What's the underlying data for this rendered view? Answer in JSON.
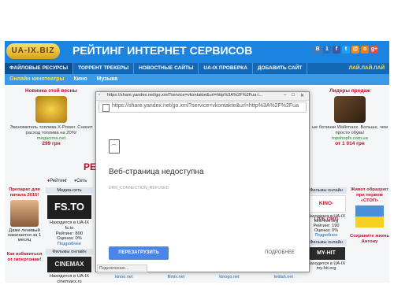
{
  "site": {
    "logo_text": "UA-IX.BIZ",
    "title": "РЕЙТИНГ ИНТЕРНЕТ СЕРВИСОВ",
    "social": [
      {
        "label": "В",
        "color": "#4a76a8",
        "icon": "vk-icon"
      },
      {
        "label": "1",
        "color": "#2a6ebb",
        "icon": "one-icon"
      },
      {
        "label": "f",
        "color": "#3b5998",
        "icon": "facebook-icon"
      },
      {
        "label": "t",
        "color": "#1da1f2",
        "icon": "twitter-icon"
      },
      {
        "label": "@",
        "color": "#f28b0c",
        "icon": "mail-icon"
      },
      {
        "label": "o",
        "color": "#ee8208",
        "icon": "ok-icon"
      },
      {
        "label": "g+",
        "color": "#dc4e41",
        "icon": "googleplus-icon"
      }
    ]
  },
  "nav": {
    "items": [
      "ФАЙЛОВЫЕ РЕСУРСЫ",
      "ТОРРЕНТ ТРЕКЕРЫ",
      "НОВОСТНЫЕ САЙТЫ",
      "UA-IX ПРОВЕРКА",
      "ДОБАВИТЬ САЙТ"
    ],
    "right": "ЛАЙ.ЛАЙ.ЛАЙ",
    "sub": [
      "Онлайн кинотеатры",
      "Кино",
      "Музыка"
    ]
  },
  "promo_left": {
    "title": "Новинка этой весны",
    "text": "Экономитель топлива X-Power. Снизит расход топлива на 20%!",
    "url": "megacima.net",
    "price": "299 грн"
  },
  "promo_right": {
    "title": "Лидеры продаж",
    "text": "ые ботинки Walkmaxx. Больше, чем просто обувь!",
    "url": "topshopfx.com.ua",
    "price": "от 1 014 грн"
  },
  "letter": "РЕ",
  "hint_left": "Рейтинг",
  "hint_right": "Сеть",
  "lower_left": {
    "title": "Препарат для начала 2015!",
    "caption": "Даже ленивый накачается за 1 месяц"
  },
  "lower_left2": "Как избавиться от гипертонии!",
  "card": {
    "header": "Медиа-сеть",
    "logo": "FS.TO",
    "lines": [
      "Находится в UA-IX",
      "fs.to",
      "Рейтинг: 800",
      "Оценка: 0%"
    ],
    "link": "Подробнее",
    "header2": "Фильмы онлайн",
    "logo2": "CINEMAX",
    "line2": "Находится в UA-IX",
    "url2": "cinemaxx.ru"
  },
  "rcard": {
    "header": "Фильмы онлайн",
    "logo": "KINO-LIVE.ORG",
    "lines": [
      "Находится в UA-IX",
      "kino-live.org",
      "Рейтинг: 190",
      "Оценка: 0%"
    ],
    "link": "Подробнее",
    "header2": "Фильмы онлайн",
    "logo2": "MY-HIT",
    "line2": "Находится в UA-IX",
    "url2": "my-hit.org"
  },
  "far_right": {
    "title": "Живот образуют при первом «СТОП»",
    "title2": "Сохраните жизнь Антону"
  },
  "bottom_links": [
    "kinoo.net",
    "filmix.net",
    "kinogo.net",
    "tetitah.net"
  ],
  "browser": {
    "title": "https://share.yandex.net/go.xml?service=vkontakte&url=http%3A%2F%2Fua-i...",
    "address": "https://share.yandex.net/go.xml?service=vkontakte&url=http%3A%2F%2Fua",
    "error_title": "Веб-страница недоступна",
    "error_code": "ERR_CONNECTION_REFUSED",
    "reload": "ПЕРЕЗАГРУЗИТЬ",
    "details": "ПОДРОБНЕЕ",
    "status": "Подключение..."
  }
}
